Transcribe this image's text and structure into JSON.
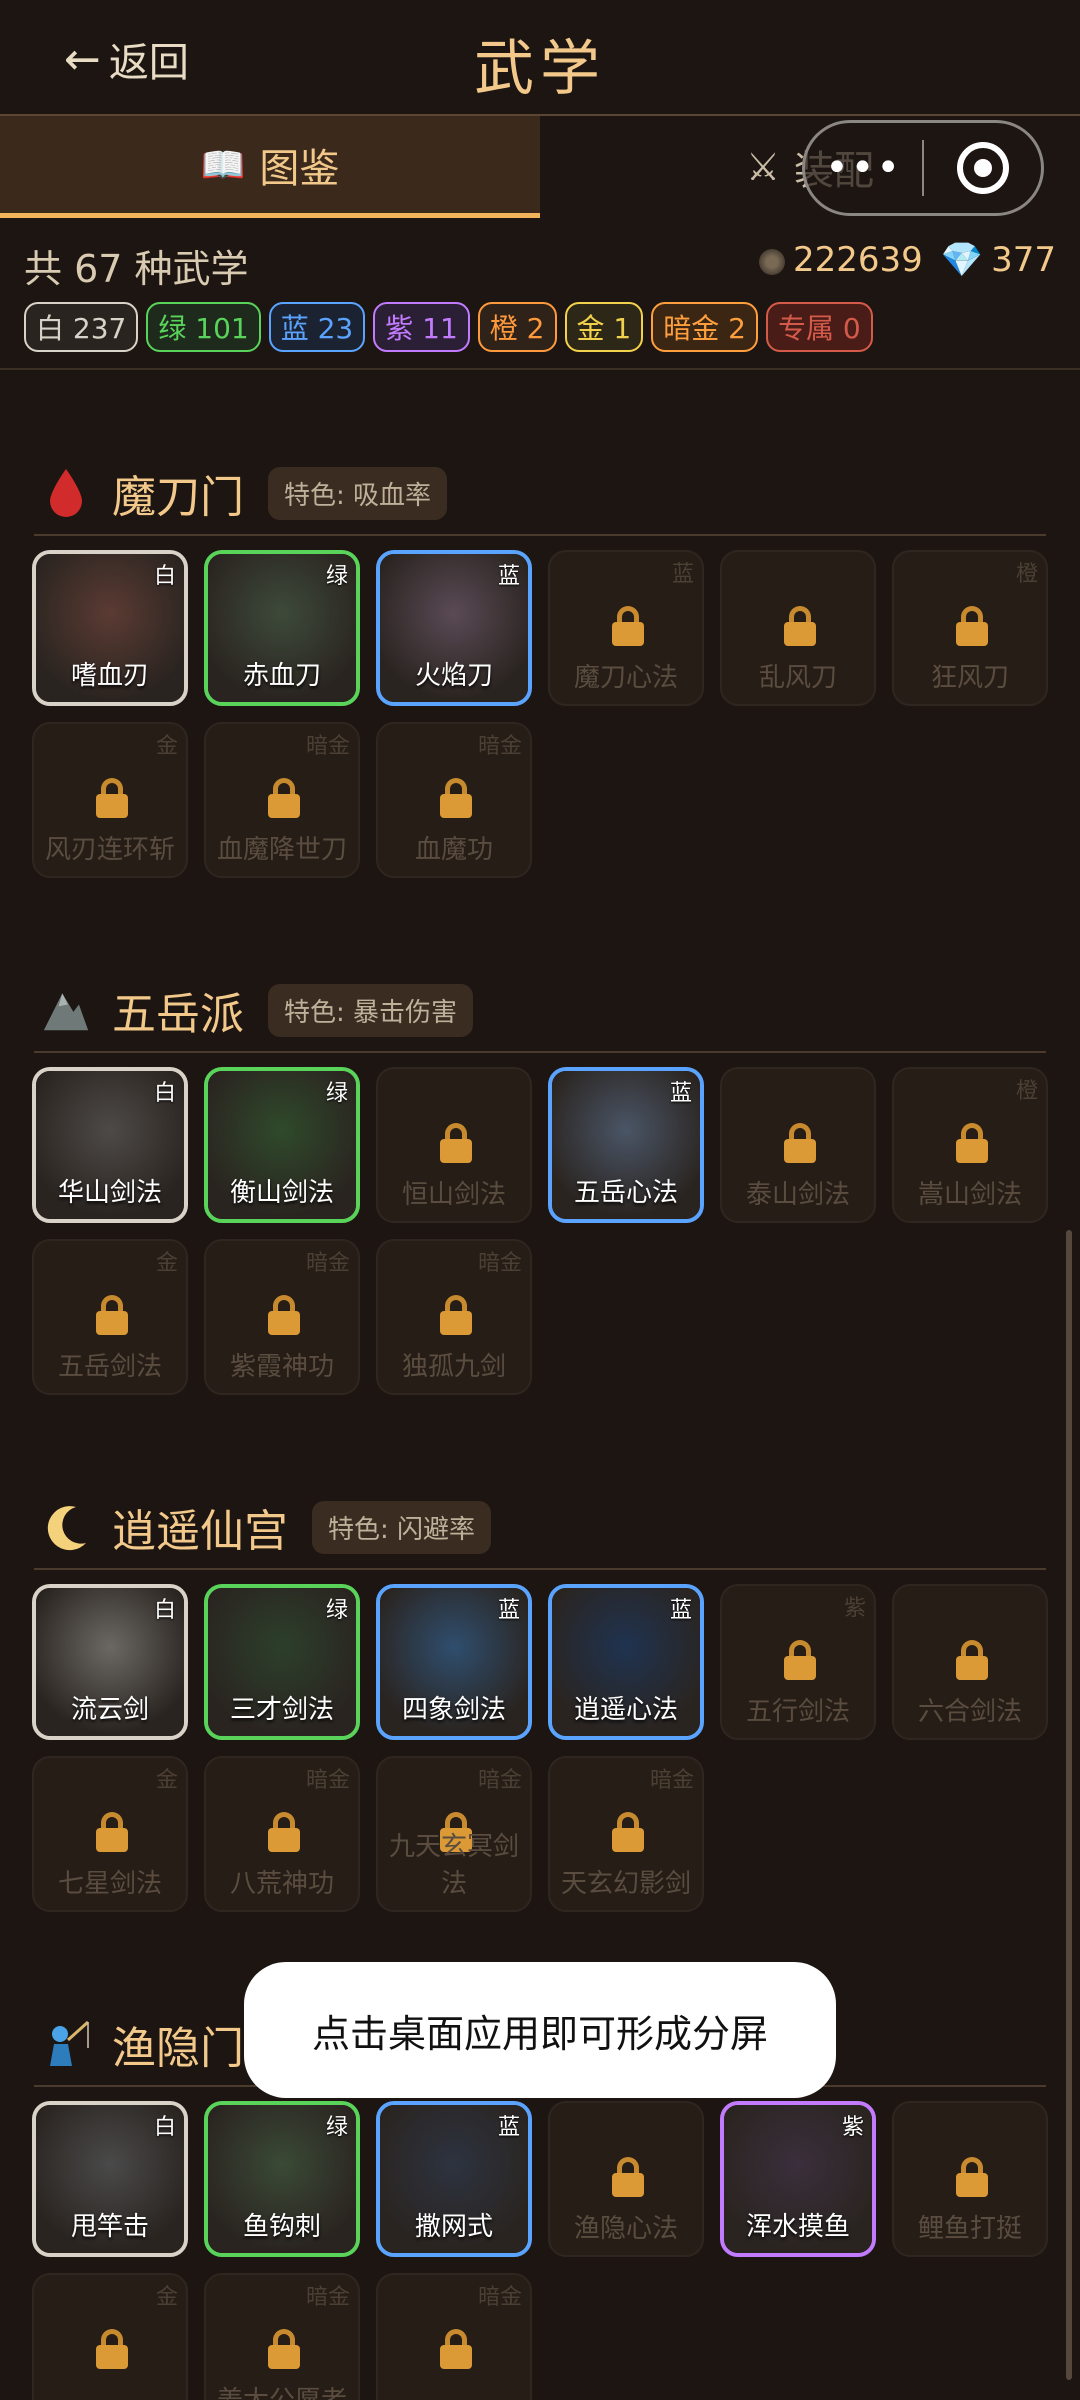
{
  "header": {
    "back_label": "返回",
    "title": "武学"
  },
  "tabs": [
    {
      "label": "图鉴",
      "icon": "book-icon"
    },
    {
      "label": "装配",
      "icon": "swords-icon"
    }
  ],
  "summary": {
    "total": "共 67 种武学",
    "coins": "222639",
    "gems": "377"
  },
  "rarity_badges": [
    {
      "label": "白 237",
      "color": "#d8d2c8",
      "bg": "#2a2420"
    },
    {
      "label": "绿 101",
      "color": "#59d35a",
      "bg": "#1e2a1c"
    },
    {
      "label": "蓝 23",
      "color": "#5aa3ff",
      "bg": "#1b2333"
    },
    {
      "label": "紫 11",
      "color": "#c27bff",
      "bg": "#2a1f34"
    },
    {
      "label": "橙 2",
      "color": "#ff9a3c",
      "bg": "#2f2218"
    },
    {
      "label": "金 1",
      "color": "#f2d14c",
      "bg": "#2c2716"
    },
    {
      "label": "暗金 2",
      "color": "#ff9e3d",
      "bg": "#3a2613"
    },
    {
      "label": "专属 0",
      "color": "#d45a4a",
      "bg": "#4a1c17"
    }
  ],
  "sections": [
    {
      "name": "魔刀门",
      "tag": "特色: 吸血率",
      "icon": "blood-drop-icon",
      "items": [
        {
          "name": "嗜血刃",
          "rarity": "白",
          "unlocked": true,
          "border": "#d8d2c8",
          "art": "#5b3b33"
        },
        {
          "name": "赤血刀",
          "rarity": "绿",
          "unlocked": true,
          "border": "#59d35a",
          "art": "#3d4a3a"
        },
        {
          "name": "火焰刀",
          "rarity": "蓝",
          "unlocked": true,
          "border": "#5aa3ff",
          "art": "#5a4a55"
        },
        {
          "name": "魔刀心法",
          "rarity": "蓝",
          "unlocked": false
        },
        {
          "name": "乱风刀",
          "rarity": "",
          "unlocked": false
        },
        {
          "name": "狂风刀",
          "rarity": "橙",
          "unlocked": false
        },
        {
          "name": "风刃连环斩",
          "rarity": "金",
          "unlocked": false
        },
        {
          "name": "血魔降世刀",
          "rarity": "暗金",
          "unlocked": false
        },
        {
          "name": "血魔功",
          "rarity": "暗金",
          "unlocked": false
        }
      ]
    },
    {
      "name": "五岳派",
      "tag": "特色: 暴击伤害",
      "icon": "mountain-icon",
      "items": [
        {
          "name": "华山剑法",
          "rarity": "白",
          "unlocked": true,
          "border": "#d8d2c8",
          "art": "#4e4a47"
        },
        {
          "name": "衡山剑法",
          "rarity": "绿",
          "unlocked": true,
          "border": "#59d35a",
          "art": "#2f4a2b"
        },
        {
          "name": "恒山剑法",
          "rarity": "",
          "unlocked": false
        },
        {
          "name": "五岳心法",
          "rarity": "蓝",
          "unlocked": true,
          "border": "#5aa3ff",
          "art": "#4a5566"
        },
        {
          "name": "泰山剑法",
          "rarity": "",
          "unlocked": false
        },
        {
          "name": "嵩山剑法",
          "rarity": "橙",
          "unlocked": false
        },
        {
          "name": "五岳剑法",
          "rarity": "金",
          "unlocked": false
        },
        {
          "name": "紫霞神功",
          "rarity": "暗金",
          "unlocked": false
        },
        {
          "name": "独孤九剑",
          "rarity": "暗金",
          "unlocked": false
        }
      ]
    },
    {
      "name": "逍遥仙宫",
      "tag": "特色: 闪避率",
      "icon": "moon-icon",
      "items": [
        {
          "name": "流云剑",
          "rarity": "白",
          "unlocked": true,
          "border": "#d8d2c8",
          "art": "#6b6864"
        },
        {
          "name": "三才剑法",
          "rarity": "绿",
          "unlocked": true,
          "border": "#59d35a",
          "art": "#2c3f2b"
        },
        {
          "name": "四象剑法",
          "rarity": "蓝",
          "unlocked": true,
          "border": "#5aa3ff",
          "art": "#2f4e6e"
        },
        {
          "name": "逍遥心法",
          "rarity": "蓝",
          "unlocked": true,
          "border": "#5aa3ff",
          "art": "#1f3350"
        },
        {
          "name": "五行剑法",
          "rarity": "紫",
          "unlocked": false
        },
        {
          "name": "六合剑法",
          "rarity": "",
          "unlocked": false
        },
        {
          "name": "七星剑法",
          "rarity": "金",
          "unlocked": false
        },
        {
          "name": "八荒神功",
          "rarity": "暗金",
          "unlocked": false
        },
        {
          "name": "九天玄冥剑法",
          "rarity": "暗金",
          "unlocked": false
        },
        {
          "name": "天玄幻影剑",
          "rarity": "暗金",
          "unlocked": false
        }
      ]
    },
    {
      "name": "渔隐门",
      "tag": "",
      "icon": "fisher-icon",
      "items": [
        {
          "name": "甩竿击",
          "rarity": "白",
          "unlocked": true,
          "border": "#d8d2c8",
          "art": "#4a4a4a"
        },
        {
          "name": "鱼钩刺",
          "rarity": "绿",
          "unlocked": true,
          "border": "#59d35a",
          "art": "#3a4a36"
        },
        {
          "name": "撒网式",
          "rarity": "蓝",
          "unlocked": true,
          "border": "#5aa3ff",
          "art": "#2d3340"
        },
        {
          "name": "渔隐心法",
          "rarity": "",
          "unlocked": false
        },
        {
          "name": "浑水摸鱼",
          "rarity": "紫",
          "unlocked": true,
          "border": "#c27bff",
          "art": "#3a2f3c"
        },
        {
          "name": "鲤鱼打挺",
          "rarity": "",
          "unlocked": false
        },
        {
          "name": "",
          "rarity": "金",
          "unlocked": false
        },
        {
          "name": "姜太公愿者",
          "rarity": "暗金",
          "unlocked": false
        },
        {
          "name": "",
          "rarity": "暗金",
          "unlocked": false
        }
      ]
    }
  ],
  "toast": {
    "text": "点击桌面应用即可形成分屏"
  },
  "capsule": {
    "more_label": "•••",
    "close_label": "close"
  }
}
